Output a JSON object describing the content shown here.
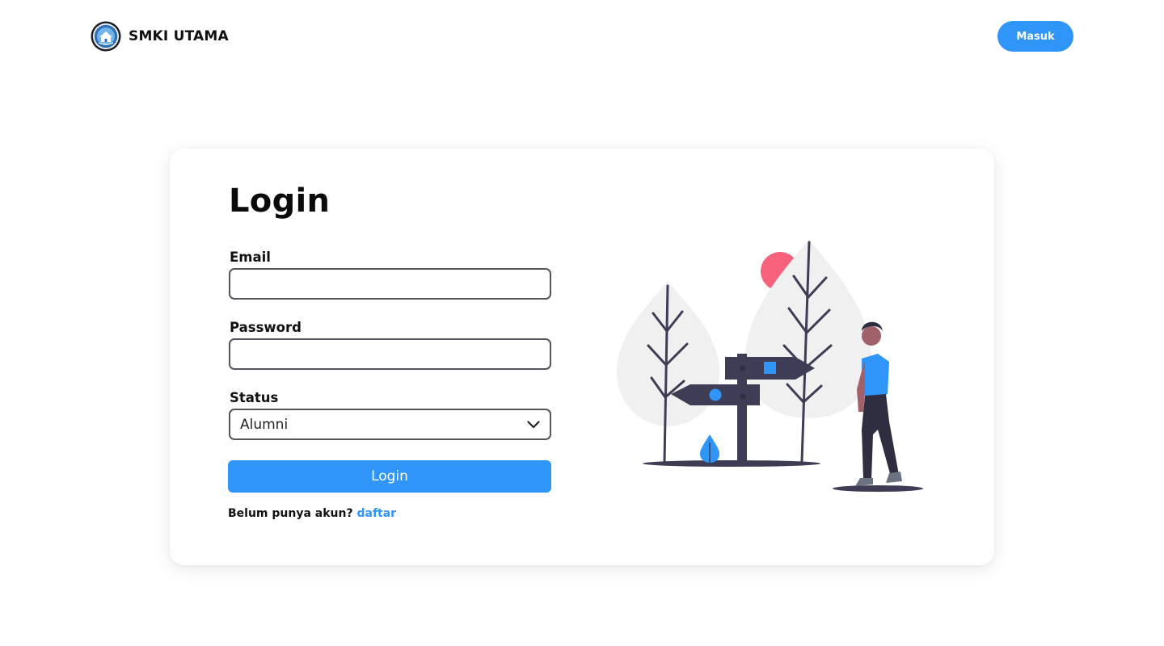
{
  "header": {
    "brand_name": "SMKI UTAMA",
    "masuk_label": "Masuk"
  },
  "form": {
    "title": "Login",
    "email_label": "Email",
    "email_value": "",
    "password_label": "Password",
    "password_value": "",
    "status_label": "Status",
    "status_selected": "Alumni",
    "submit_label": "Login",
    "signup_prompt": "Belum punya akun?",
    "signup_link": "daftar"
  },
  "icons": {
    "logo": "school-emblem-icon",
    "dropdown": "chevron-down-icon",
    "illustration": "signpost-person-illustration"
  },
  "colors": {
    "accent": "#2f95f9",
    "sun": "#f7617b",
    "dark": "#3f3d56"
  }
}
